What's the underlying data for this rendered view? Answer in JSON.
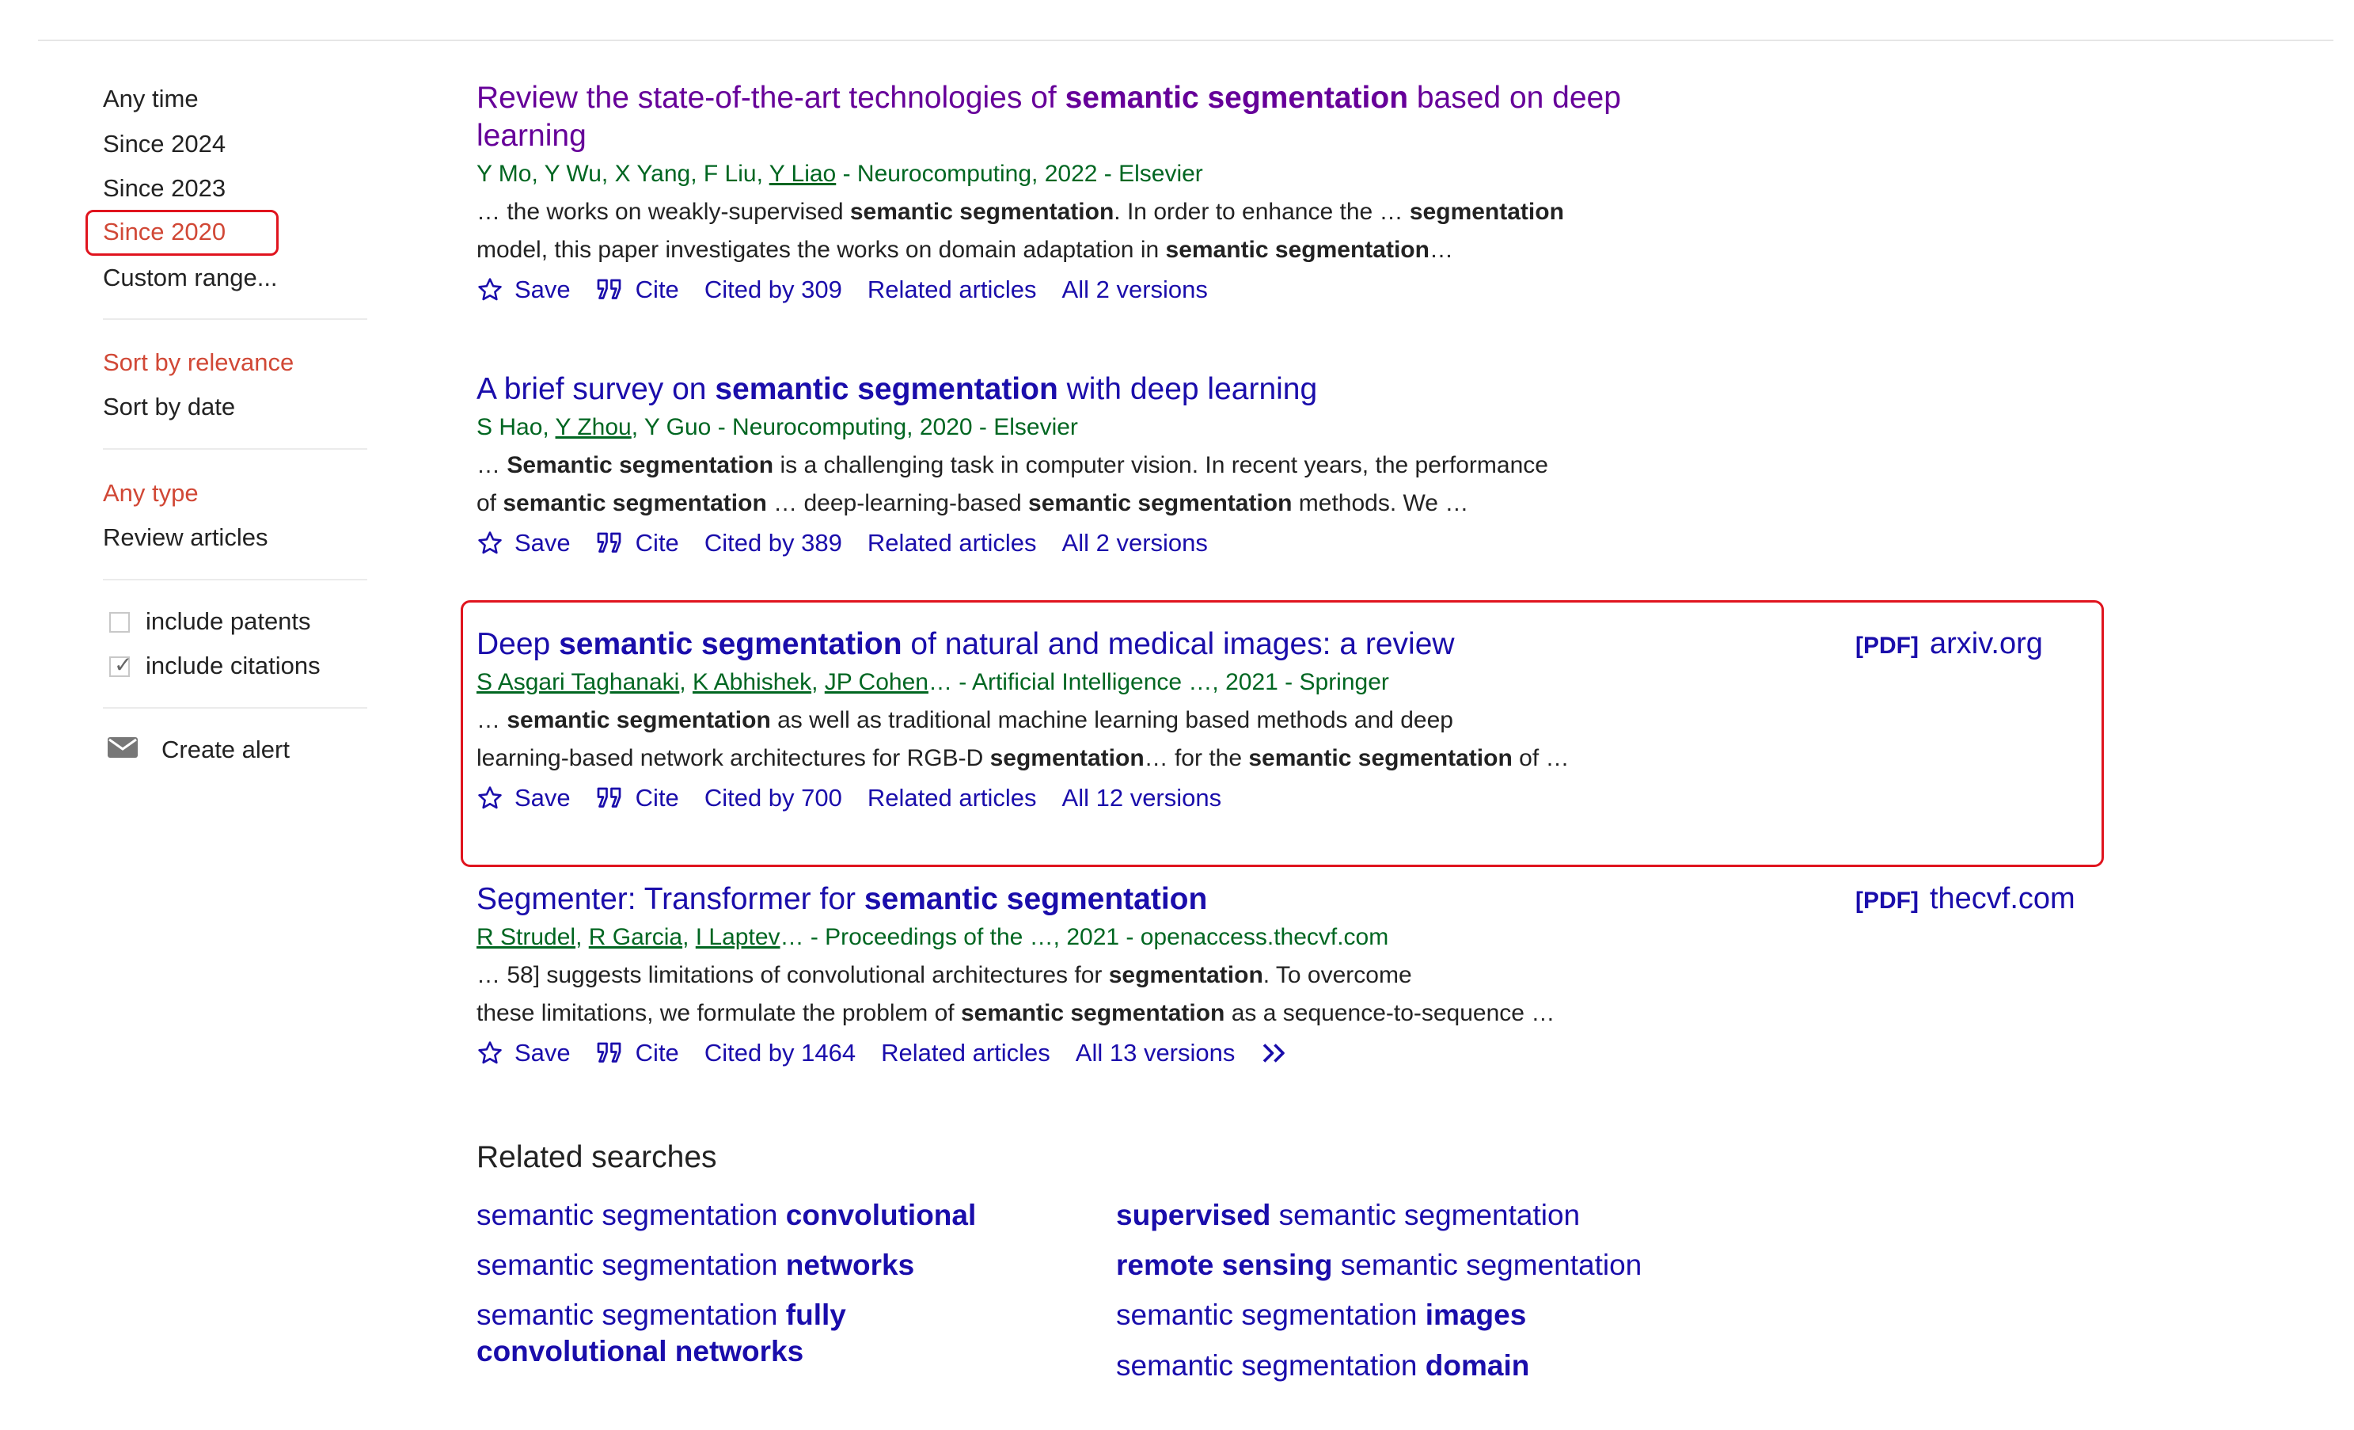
{
  "sidebar": {
    "time_filters": [
      "Any time",
      "Since 2024",
      "Since 2023",
      "Since 2020",
      "Custom range..."
    ],
    "sort_options": [
      "Sort by relevance",
      "Sort by date"
    ],
    "type_options": [
      "Any type",
      "Review articles"
    ],
    "include_patents": "include patents",
    "include_citations": "include citations",
    "create_alert": "Create alert"
  },
  "results": [
    {
      "title": [
        "Review the state-of-the-art technologies of ",
        "semantic segmentation",
        " based on deep learning"
      ],
      "authors": [
        {
          "t": "Y Mo",
          "link": false
        },
        {
          "t": ", ",
          "link": false
        },
        {
          "t": "Y Wu",
          "link": false
        },
        {
          "t": ", ",
          "link": false
        },
        {
          "t": "X Yang",
          "link": false
        },
        {
          "t": ", ",
          "link": false
        },
        {
          "t": "F Liu",
          "link": false
        },
        {
          "t": ", ",
          "link": false
        },
        {
          "t": "Y Liao",
          "link": true
        }
      ],
      "source": " - Neurocomputing, 2022 - Elsevier",
      "snippet_lines": [
        [
          "… the works on weakly-supervised ",
          "semantic segmentation",
          ". In order to enhance the … ",
          "segmentation"
        ],
        [
          "model, this paper investigates the works on domain adaptation in ",
          "semantic segmentation",
          "…"
        ]
      ],
      "actions": {
        "save": "Save",
        "cite": "Cite",
        "cited_by": "Cited by 309",
        "related": "Related articles",
        "versions": "All 2 versions"
      }
    },
    {
      "title": [
        "A brief survey on ",
        "semantic segmentation",
        " with deep learning"
      ],
      "authors": [
        {
          "t": "S Hao",
          "link": false
        },
        {
          "t": ", ",
          "link": false
        },
        {
          "t": "Y Zhou",
          "link": true
        },
        {
          "t": ", ",
          "link": false
        },
        {
          "t": "Y Guo",
          "link": false
        }
      ],
      "source": " - Neurocomputing, 2020 - Elsevier",
      "snippet_lines": [
        [
          "… ",
          "Semantic segmentation",
          " is a challenging task in computer vision. In recent years, the performance"
        ],
        [
          "of ",
          "semantic segmentation",
          " … deep-learning-based ",
          "semantic segmentation",
          " methods. We …"
        ]
      ],
      "actions": {
        "save": "Save",
        "cite": "Cite",
        "cited_by": "Cited by 389",
        "related": "Related articles",
        "versions": "All 2 versions"
      }
    },
    {
      "title": [
        "Deep ",
        "semantic segmentation",
        " of natural and medical images: a review"
      ],
      "authors": [
        {
          "t": "S Asgari Taghanaki",
          "link": true
        },
        {
          "t": ", ",
          "link": false
        },
        {
          "t": "K Abhishek",
          "link": true
        },
        {
          "t": ", ",
          "link": false
        },
        {
          "t": "JP Cohen",
          "link": true
        }
      ],
      "source": "… - Artificial Intelligence …, 2021 - Springer",
      "snippet_lines": [
        [
          "… ",
          "semantic segmentation",
          " as well as traditional machine learning based methods and deep"
        ],
        [
          "learning-based network architectures for RGB-D ",
          "segmentation",
          "… for the ",
          "semantic segmentation",
          " of …"
        ]
      ],
      "actions": {
        "save": "Save",
        "cite": "Cite",
        "cited_by": "Cited by 700",
        "related": "Related articles",
        "versions": "All 12 versions"
      },
      "pdf": {
        "tag": "[PDF]",
        "domain": "arxiv.org"
      }
    },
    {
      "title": [
        "Segmenter: Transformer for ",
        "semantic segmentation",
        ""
      ],
      "authors": [
        {
          "t": "R Strudel",
          "link": true
        },
        {
          "t": ", ",
          "link": false
        },
        {
          "t": "R Garcia",
          "link": true
        },
        {
          "t": ", ",
          "link": false
        },
        {
          "t": "I Laptev",
          "link": true
        }
      ],
      "source": "… - Proceedings of the …, 2021 - openaccess.thecvf.com",
      "snippet_lines": [
        [
          "… 58] suggests limitations of convolutional architectures for ",
          "segmentation",
          ". To overcome"
        ],
        [
          "these limitations, we formulate the problem of ",
          "semantic segmentation",
          " as a sequence-to-sequence …"
        ]
      ],
      "actions": {
        "save": "Save",
        "cite": "Cite",
        "cited_by": "Cited by 1464",
        "related": "Related articles",
        "versions": "All 13 versions"
      },
      "pdf": {
        "tag": "[PDF]",
        "domain": "thecvf.com"
      }
    }
  ],
  "related_searches": {
    "title": "Related searches",
    "items": [
      [
        "semantic segmentation ",
        "convolutional"
      ],
      [
        "",
        "supervised",
        " semantic segmentation"
      ],
      [
        "semantic segmentation ",
        "networks"
      ],
      [
        "",
        "remote sensing",
        " semantic segmentation"
      ],
      [
        "semantic segmentation ",
        "fully convolutional networks"
      ],
      [
        "semantic segmentation ",
        "images"
      ],
      [
        "",
        "",
        ""
      ],
      [
        "semantic segmentation ",
        "domain"
      ]
    ]
  },
  "colors": {
    "link": "#1a0dab",
    "visited": "#660099",
    "green": "#006621",
    "red_filter": "#d14836",
    "highlight": "#e0141e"
  }
}
